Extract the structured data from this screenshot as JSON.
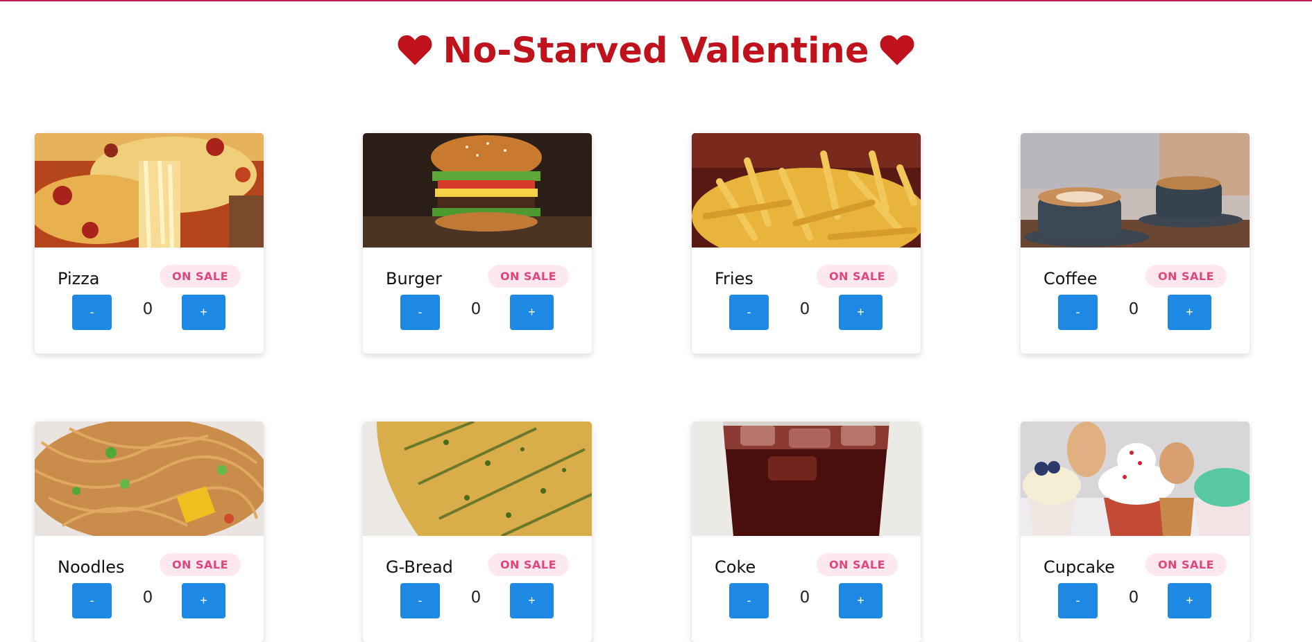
{
  "page": {
    "title": "No-Starved Valentine",
    "accent_color": "#c0121c",
    "button_color": "#1e88e5",
    "badge_color": "#e0457b"
  },
  "items": [
    {
      "name": "Pizza",
      "badge": "ON SALE",
      "minus_label": "-",
      "plus_label": "+",
      "quantity": "0",
      "image": "pizza-image"
    },
    {
      "name": "Burger",
      "badge": "ON SALE",
      "minus_label": "-",
      "plus_label": "+",
      "quantity": "0",
      "image": "burger-image"
    },
    {
      "name": "Fries",
      "badge": "ON SALE",
      "minus_label": "-",
      "plus_label": "+",
      "quantity": "0",
      "image": "fries-image"
    },
    {
      "name": "Coffee",
      "badge": "ON SALE",
      "minus_label": "-",
      "plus_label": "+",
      "quantity": "0",
      "image": "coffee-image"
    },
    {
      "name": "Noodles",
      "badge": "ON SALE",
      "minus_label": "-",
      "plus_label": "+",
      "quantity": "0",
      "image": "noodles-image"
    },
    {
      "name": "G-Bread",
      "badge": "ON SALE",
      "minus_label": "-",
      "plus_label": "+",
      "quantity": "0",
      "image": "garlic-bread-image"
    },
    {
      "name": "Coke",
      "badge": "ON SALE",
      "minus_label": "-",
      "plus_label": "+",
      "quantity": "0",
      "image": "coke-image"
    },
    {
      "name": "Cupcake",
      "badge": "ON SALE",
      "minus_label": "-",
      "plus_label": "+",
      "quantity": "0",
      "image": "cupcake-image"
    }
  ]
}
